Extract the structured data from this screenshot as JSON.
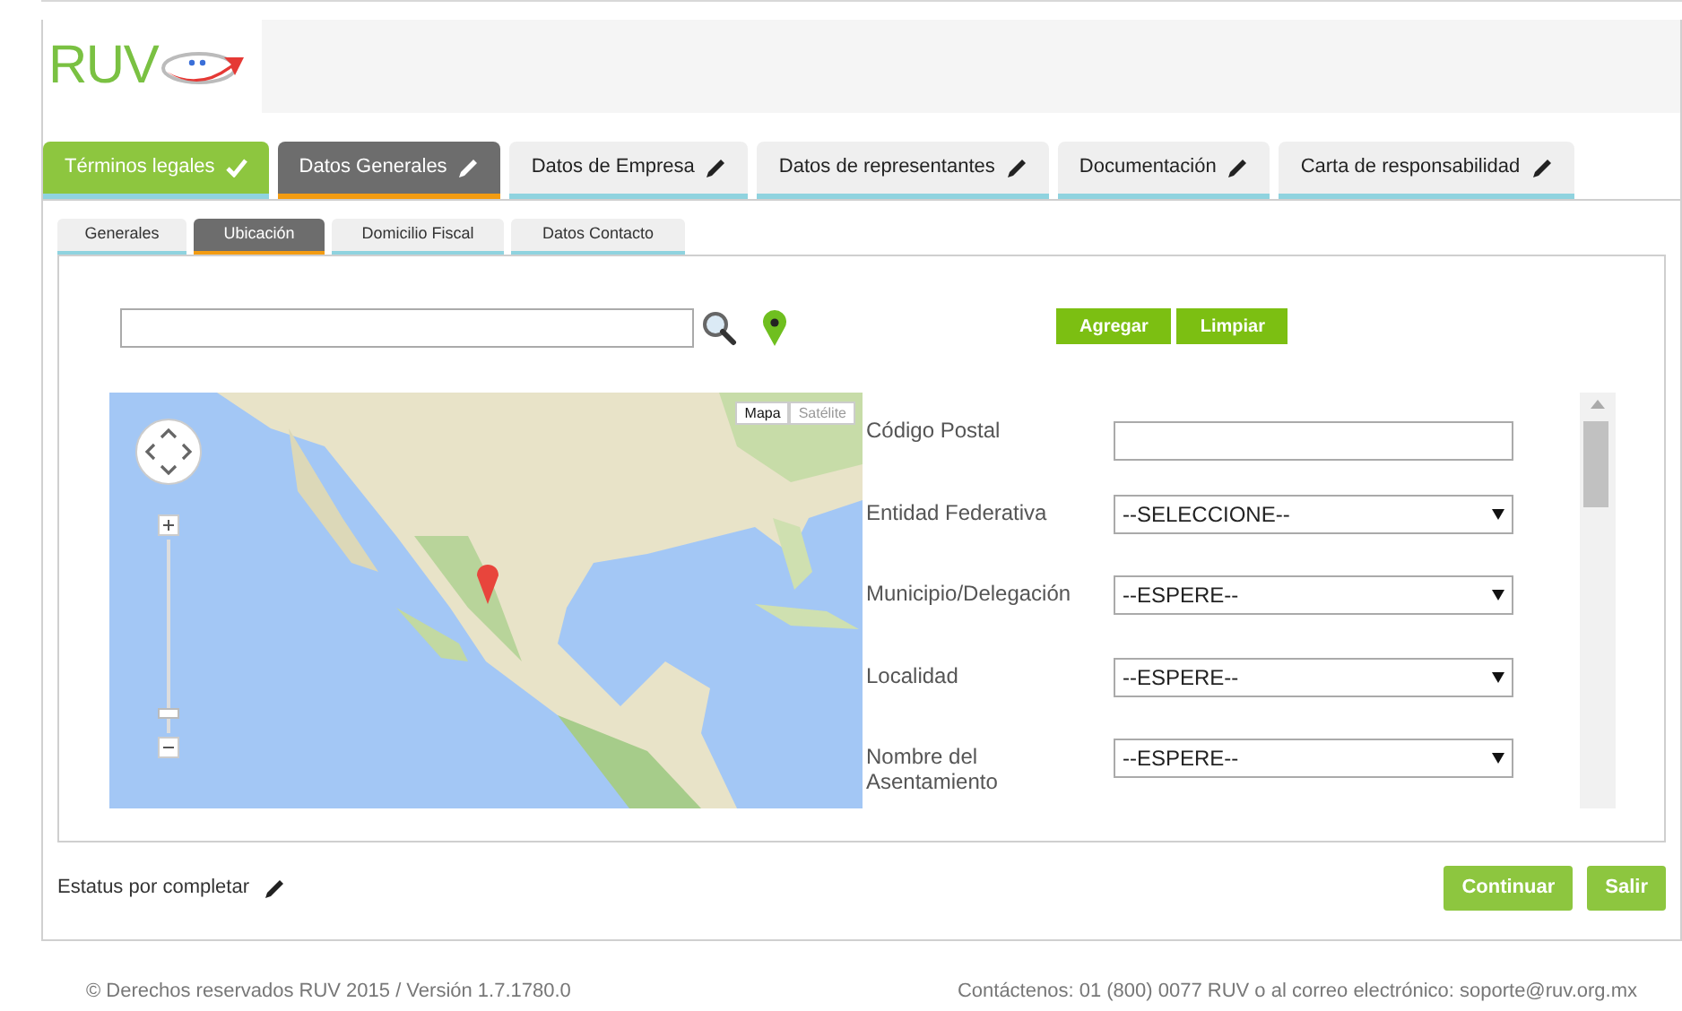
{
  "header": {
    "logo": "RUV"
  },
  "main_tabs": [
    {
      "label": "Términos legales",
      "completed": true,
      "selected": false
    },
    {
      "label": "Datos Generales",
      "completed": false,
      "selected": true
    },
    {
      "label": "Datos de Empresa",
      "completed": false,
      "selected": false
    },
    {
      "label": "Datos de representantes",
      "completed": false,
      "selected": false
    },
    {
      "label": "Documentación",
      "completed": false,
      "selected": false
    },
    {
      "label": "Carta de responsabilidad",
      "completed": false,
      "selected": false
    }
  ],
  "sub_tabs": [
    {
      "label": "Generales",
      "selected": false
    },
    {
      "label": "Ubicación",
      "selected": true
    },
    {
      "label": "Domicilio Fiscal",
      "selected": false
    },
    {
      "label": "Datos Contacto",
      "selected": false
    }
  ],
  "search_actions": [
    "Agregar",
    "Limpiar"
  ],
  "map": {
    "kind": "picture",
    "zoom": {
      "level": 0.08
    },
    "type_buttons": [
      {
        "label": "Mapa",
        "selected": true
      },
      {
        "label": "Satélite",
        "selected": false
      }
    ]
  },
  "form_fields": [
    {
      "label": "Código Postal",
      "kind": "text"
    },
    {
      "label": "Entidad Federativa",
      "kind": "select",
      "value": "--SELECCIONE--"
    },
    {
      "label": "Municipio/Delegación",
      "kind": "select",
      "value": "--ESPERE--"
    },
    {
      "label": "Localidad",
      "kind": "select",
      "value": "--ESPERE--"
    },
    {
      "label": "Nombre del Asentamiento",
      "kind": "select",
      "value": "--ESPERE--"
    }
  ],
  "status": "Estatus por completar",
  "buttons": [
    "Continuar",
    "Salir"
  ],
  "footer": {
    "copyright": "© Derechos reservados RUV 2015 / Versión 1.7.1780.0",
    "contact": "Contáctenos: 01 (800) 0077 RUV o al correo electrónico: soporte@ruv.org.mx"
  }
}
